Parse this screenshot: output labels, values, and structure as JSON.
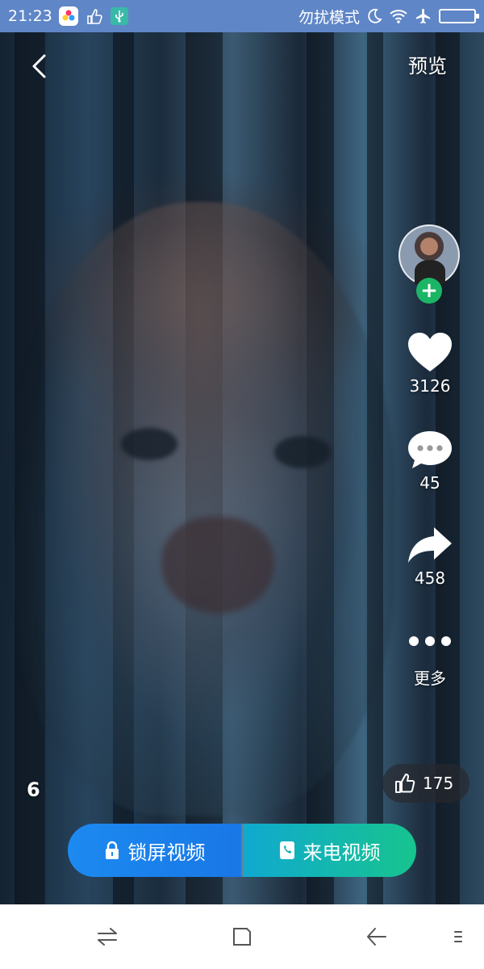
{
  "status_bar": {
    "time": "21:23",
    "dnd_label": "勿扰模式",
    "icons": [
      "photo-app-icon",
      "hand-icon",
      "usb-icon",
      "moon-icon",
      "wifi-icon",
      "airplane-icon",
      "battery-icon"
    ]
  },
  "header": {
    "back_icon": "chevron-left-icon",
    "preview_label": "预览"
  },
  "sidebar": {
    "follow_symbol": "+",
    "likes": "3126",
    "comments": "45",
    "shares": "458",
    "more_label": "更多"
  },
  "video": {
    "page_number": "6",
    "thumbs_count": "175"
  },
  "cta": {
    "lock_label": "锁屏视频",
    "call_label": "来电视频"
  },
  "nav_bar": {
    "icons": [
      "switch-icon",
      "home-square-icon",
      "back-arrow-icon",
      "menu-icon"
    ]
  },
  "colors": {
    "status_bar": "#5f86c7",
    "follow_green": "#1bb565",
    "cta_blue": "#1c8af0",
    "cta_green": "#17c48e"
  }
}
